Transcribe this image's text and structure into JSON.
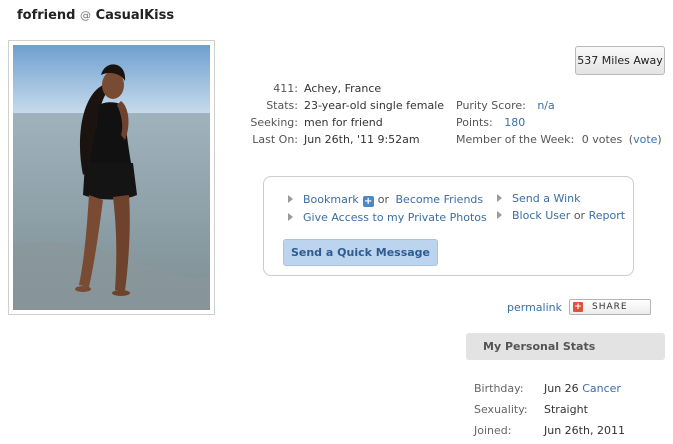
{
  "header": {
    "username": "fofriend",
    "at": "@",
    "site": "CasualKiss"
  },
  "distance_button": "537 Miles Away",
  "info_labels": {
    "location": "411:",
    "stats": "Stats:",
    "seeking": "Seeking:",
    "last_on": "Last On:"
  },
  "info_values": {
    "location": "Achey, France",
    "stats": "23-year-old single female",
    "seeking": "men for friend",
    "last_on": "Jun 26th, '11 9:52am"
  },
  "scores": {
    "purity_label": "Purity Score:",
    "purity_value": "n/a",
    "points_label": "Points:",
    "points_value": "180",
    "motw_label": "Member of the Week:",
    "motw_votes": "0 votes",
    "motw_paren_open": "(",
    "motw_vote_link": "vote",
    "motw_paren_close": ")"
  },
  "actions": {
    "bookmark": "Bookmark",
    "or_1": "or",
    "become_friends": "Become Friends",
    "give_access": "Give Access to my Private Photos",
    "send_wink": "Send a Wink",
    "block_user": "Block User",
    "or_2": "or",
    "report": "Report",
    "quick_message": "Send a Quick Message"
  },
  "permalink": "permalink",
  "share": "SHARE",
  "personal_stats": {
    "header": "My Personal Stats",
    "rows": [
      {
        "label": "Birthday:",
        "value": "Jun 26",
        "extra": "Cancer"
      },
      {
        "label": "Sexuality:",
        "value": "Straight",
        "extra": ""
      },
      {
        "label": "Joined:",
        "value": "Jun 26th, 2011",
        "extra": ""
      }
    ]
  },
  "colors": {
    "link": "#3b6ea5",
    "button_blue": "#bdd4ee",
    "stats_header_bg": "#e3e3e3"
  },
  "icons": {
    "plus": "plus-icon",
    "arrow": "triangle-right-icon",
    "share": "share-icon"
  }
}
